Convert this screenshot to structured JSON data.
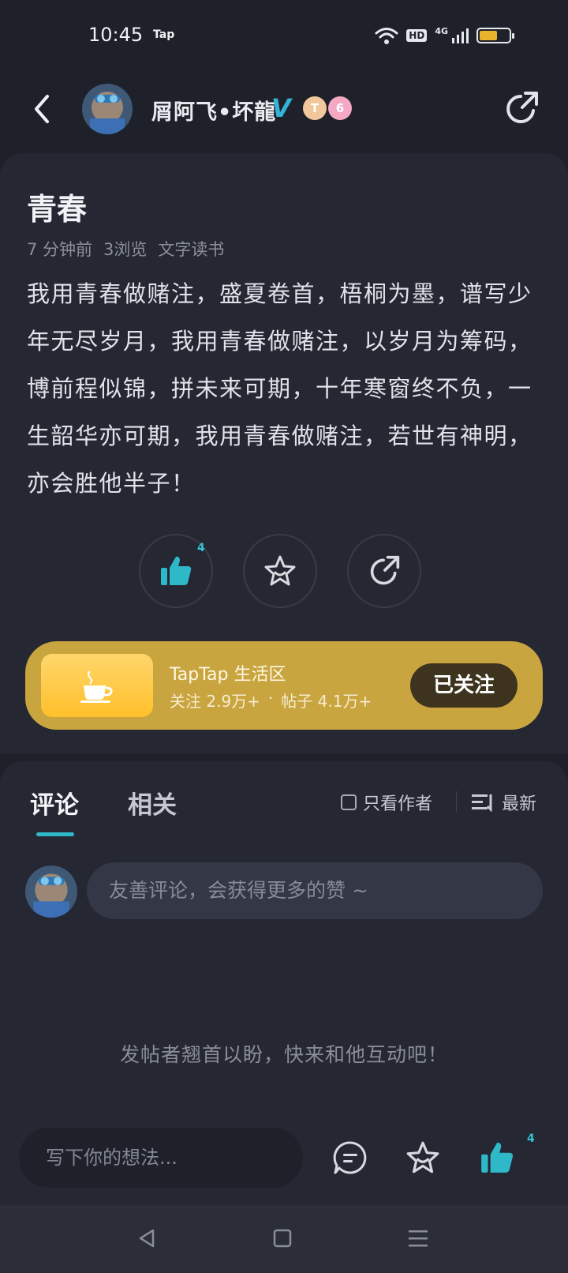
{
  "status_bar": {
    "time": "10:45",
    "app_indicator": "Tap",
    "hd_label": "HD",
    "network_label": "4G",
    "battery_level": 0.6
  },
  "header": {
    "author_name": "屑阿飞•坏龍",
    "badge_t": "T",
    "badge_six": "6",
    "icons": [
      "back-arrow-icon",
      "avatar",
      "verified-v-icon",
      "share-icon"
    ]
  },
  "post": {
    "title": "青春",
    "time_ago": "7 分钟前",
    "views": "3浏览",
    "category": "文字读书",
    "body": "我用青春做赌注，盛夏卷首，梧桐为墨，谱写少年无尽岁月，我用青春做赌注，以岁月为筹码，博前程似锦，拼未来可期，十年寒窗终不负，一生韶华亦可期，我用青春做赌注，若世有神明，亦会胜他半子！",
    "like_count": "4"
  },
  "community": {
    "name": "TapTap 生活区",
    "followers": "关注 2.9万+",
    "separator": "·",
    "posts": "帖子 4.1万+",
    "follow_label": "已关注"
  },
  "comments": {
    "tab_comments": "评论",
    "tab_related": "相关",
    "author_only_label": "只看作者",
    "sort_label": "最新",
    "input_placeholder": "友善评论，会获得更多的赞 ~",
    "empty_hint": "发帖者翘首以盼，快来和他互动吧！"
  },
  "bottom_bar": {
    "write_placeholder": "写下你的想法...",
    "like_count": "4"
  },
  "colors": {
    "background": "#1f212a",
    "card": "#252733",
    "accent": "#2fb9c8",
    "community": "#c9a53f"
  }
}
